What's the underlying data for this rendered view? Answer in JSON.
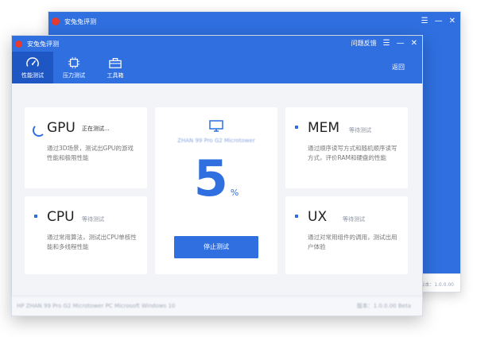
{
  "app": {
    "title": "安兔兔评测"
  },
  "back_window": {
    "title": "安兔兔评测",
    "controls": [
      "☰",
      "—",
      "✕"
    ],
    "version": "版本：1.0.0.00"
  },
  "front_window": {
    "title": "安兔兔评测",
    "feedback_label": "问题反馈",
    "controls": [
      "☰",
      "—",
      "✕"
    ],
    "back_label": "返回",
    "nav": [
      {
        "label": "性能测试",
        "icon": "gauge-icon",
        "active": true
      },
      {
        "label": "压力测试",
        "icon": "chip-icon",
        "active": false
      },
      {
        "label": "工具箱",
        "icon": "toolbox-icon",
        "active": false
      }
    ],
    "tests": {
      "gpu": {
        "name": "GPU",
        "status": "正在测试...",
        "desc": "通过3D场景，测试出GPU的游戏性能和极限性能"
      },
      "cpu": {
        "name": "CPU",
        "status": "等待测试",
        "desc": "通过常用算法，测试出CPU单核性能和多线程性能"
      },
      "mem": {
        "name": "MEM",
        "status": "等待测试",
        "desc": "通过顺序读写方式和随机顺序读写方式，评价RAM和硬盘的性能"
      },
      "ux": {
        "name": "UX",
        "status": "等待测试",
        "desc": "通过对常用组件的调用，测试出用户体验"
      }
    },
    "progress": {
      "machine": "ZHAN 99 Pro G2 Microtower",
      "value": "5",
      "unit": "%",
      "stop_label": "停止测试"
    },
    "status_bar": {
      "left": "HP ZHAN 99 Pro G2 Microtower PC   Microsoft Windows 10",
      "right": "版本：1.0.0.00 Beta"
    }
  },
  "colors": {
    "accent": "#2f6fe0",
    "nav_active": "#1e56c4",
    "logo": "#e63b2e"
  }
}
